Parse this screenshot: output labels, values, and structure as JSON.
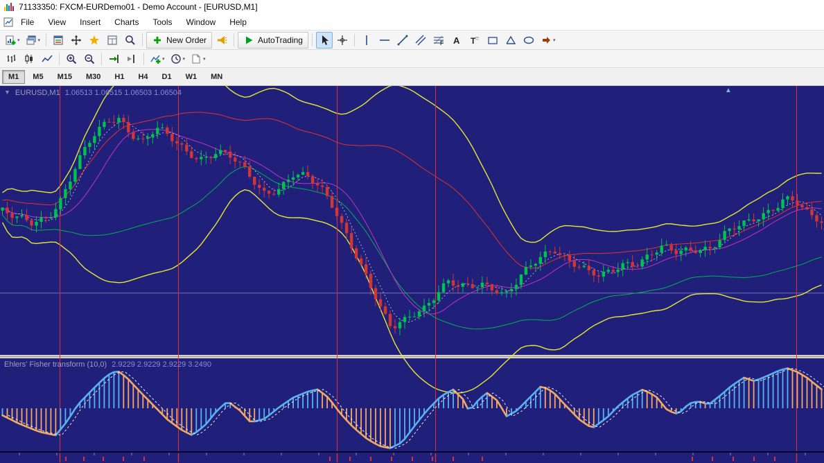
{
  "window": {
    "title": "71133350: FXCM-EURDemo01 - Demo Account - [EURUSD,M1]"
  },
  "menu": {
    "items": [
      "File",
      "View",
      "Insert",
      "Charts",
      "Tools",
      "Window",
      "Help"
    ]
  },
  "toolbar1": {
    "items": [
      {
        "icon": "new-chart",
        "name": "new-chart-button",
        "caret": true
      },
      {
        "icon": "profiles",
        "name": "profiles-button",
        "caret": true
      },
      {
        "sep": true
      },
      {
        "icon": "market-watch",
        "name": "market-watch-button"
      },
      {
        "icon": "navigator",
        "name": "navigator-button"
      },
      {
        "icon": "favorites",
        "name": "favorites-button"
      },
      {
        "icon": "data-window",
        "name": "data-window-button"
      },
      {
        "icon": "search",
        "name": "search-button"
      },
      {
        "sep": true
      },
      {
        "icon": "order-plus",
        "name": "new-order-button",
        "label": "New Order"
      },
      {
        "icon": "alerts",
        "name": "alerts-button"
      },
      {
        "sep": true
      },
      {
        "icon": "play",
        "name": "autotrading-button",
        "label": "AutoTrading"
      },
      {
        "sep": true
      },
      {
        "icon": "cursor",
        "name": "cursor-tool-button",
        "pressed": true
      },
      {
        "icon": "crosshair",
        "name": "crosshair-tool-button"
      },
      {
        "sep": true
      },
      {
        "icon": "vline",
        "name": "vertical-line-tool-button"
      },
      {
        "icon": "hline",
        "name": "horizontal-line-tool-button"
      },
      {
        "icon": "tline",
        "name": "trendline-tool-button"
      },
      {
        "icon": "channel",
        "name": "equidistant-channel-tool-button"
      },
      {
        "icon": "fibo",
        "name": "fibonacci-retracement-tool-button"
      },
      {
        "icon": "text",
        "name": "text-tool-button"
      },
      {
        "icon": "label",
        "name": "text-label-tool-button"
      },
      {
        "icon": "rect-shape",
        "name": "rectangle-tool-button"
      },
      {
        "icon": "triangle-shape",
        "name": "triangle-tool-button"
      },
      {
        "icon": "ellipse-shape",
        "name": "ellipse-tool-button"
      },
      {
        "icon": "arrows",
        "name": "arrows-tool-button",
        "caret": true
      }
    ]
  },
  "toolbar2": {
    "items": [
      {
        "icon": "bars-chart",
        "name": "bar-chart-button"
      },
      {
        "icon": "candles-chart",
        "name": "candlestick-chart-button"
      },
      {
        "icon": "line-chart",
        "name": "line-chart-button"
      },
      {
        "sep": true
      },
      {
        "icon": "zoom-in",
        "name": "zoom-in-button"
      },
      {
        "icon": "zoom-out",
        "name": "zoom-out-button"
      },
      {
        "sep": true
      },
      {
        "icon": "auto-scroll",
        "name": "auto-scroll-button"
      },
      {
        "icon": "chart-shift",
        "name": "chart-shift-button"
      },
      {
        "sep": true
      },
      {
        "icon": "indicators",
        "name": "indicators-button",
        "caret": true
      },
      {
        "icon": "periods",
        "name": "periods-button",
        "caret": true
      },
      {
        "icon": "templates",
        "name": "templates-button",
        "caret": true
      }
    ]
  },
  "timeframes": {
    "items": [
      "M1",
      "M5",
      "M15",
      "M30",
      "H1",
      "H4",
      "D1",
      "W1",
      "MN"
    ],
    "active": "M1"
  },
  "chart": {
    "symbol_label": "EURUSD,M1",
    "ohlc": "1.06513 1.06515 1.06503 1.06504",
    "indicator_label": "Ehlers' Fisher transform (10,0)",
    "indicator_values": "2.9229 2.9229 2.9229 3.2490",
    "collapse_marker": "▼",
    "corner_marker": "▲"
  },
  "chart_data": {
    "type": "candlestick",
    "symbol": "EURUSD",
    "timeframe": "M1",
    "open": 1.06513,
    "high": 1.06515,
    "low": 1.06503,
    "close": 1.06504,
    "current_price": 1.06504,
    "price_axis": {
      "top": 1.0692,
      "bottom": 1.0638
    },
    "num_candles": 170,
    "price_path": [
      [
        0.0,
        1.0667
      ],
      [
        0.015,
        1.0665
      ],
      [
        0.035,
        1.0664
      ],
      [
        0.055,
        1.0666
      ],
      [
        0.072,
        1.067
      ],
      [
        0.09,
        1.0676
      ],
      [
        0.11,
        1.0681
      ],
      [
        0.13,
        1.0685
      ],
      [
        0.143,
        1.0686
      ],
      [
        0.158,
        1.0683
      ],
      [
        0.172,
        1.0681
      ],
      [
        0.188,
        1.0683
      ],
      [
        0.205,
        1.0681
      ],
      [
        0.225,
        1.0679
      ],
      [
        0.245,
        1.0678
      ],
      [
        0.262,
        1.0679
      ],
      [
        0.28,
        1.0677
      ],
      [
        0.3,
        1.0674
      ],
      [
        0.318,
        1.0671
      ],
      [
        0.338,
        1.0672
      ],
      [
        0.355,
        1.0674
      ],
      [
        0.372,
        1.0673
      ],
      [
        0.39,
        1.0671
      ],
      [
        0.405,
        1.0668
      ],
      [
        0.42,
        1.0663
      ],
      [
        0.435,
        1.0657
      ],
      [
        0.45,
        1.0651
      ],
      [
        0.463,
        1.0646
      ],
      [
        0.475,
        1.0643
      ],
      [
        0.488,
        1.0645
      ],
      [
        0.5,
        1.0647
      ],
      [
        0.515,
        1.0648
      ],
      [
        0.53,
        1.065
      ],
      [
        0.545,
        1.0652
      ],
      [
        0.558,
        1.0651
      ],
      [
        0.572,
        1.0652
      ],
      [
        0.588,
        1.0653
      ],
      [
        0.6,
        1.0652
      ],
      [
        0.613,
        1.065
      ],
      [
        0.628,
        1.0652
      ],
      [
        0.643,
        1.0655
      ],
      [
        0.66,
        1.0658
      ],
      [
        0.673,
        1.066
      ],
      [
        0.688,
        1.0658
      ],
      [
        0.702,
        1.0656
      ],
      [
        0.716,
        1.0654
      ],
      [
        0.73,
        1.0653
      ],
      [
        0.745,
        1.0655
      ],
      [
        0.76,
        1.0657
      ],
      [
        0.775,
        1.0657
      ],
      [
        0.79,
        1.0658
      ],
      [
        0.805,
        1.0659
      ],
      [
        0.82,
        1.0658
      ],
      [
        0.835,
        1.0659
      ],
      [
        0.85,
        1.066
      ],
      [
        0.865,
        1.066
      ],
      [
        0.88,
        1.0662
      ],
      [
        0.895,
        1.0663
      ],
      [
        0.91,
        1.0664
      ],
      [
        0.925,
        1.0666
      ],
      [
        0.94,
        1.0668
      ],
      [
        0.955,
        1.067
      ],
      [
        0.968,
        1.0669
      ],
      [
        0.98,
        1.0666
      ],
      [
        1.0,
        1.0664
      ]
    ],
    "separators_x": [
      0.072,
      0.216,
      0.409,
      0.528,
      0.966
    ],
    "axis_marks": [
      0.08,
      0.102,
      0.125,
      0.15,
      0.175,
      0.4,
      0.425,
      0.45,
      0.475,
      0.5,
      0.525,
      0.55,
      0.585,
      0.84,
      0.865,
      0.89,
      0.915,
      0.94
    ],
    "colors": {
      "background": "#20207a",
      "up": "#00c24e",
      "down": "#d23535",
      "band": "#e6e635",
      "ma_red": "#e03030",
      "ma_green": "#00b050",
      "ma_center": "#c233c2",
      "ma_fast": "#cfcfe8",
      "price_line": "#8d8dc8",
      "separator": "#e03030"
    },
    "fisher": {
      "name": "Ehlers' Fisher transform",
      "params": "(10,0)",
      "last_values": [
        2.9229,
        2.9229,
        2.9229,
        3.249
      ],
      "up_color": "#5ab1f0",
      "down_color": "#f2a963",
      "signal_color": "#ffffff",
      "values_path": [
        [
          0.0,
          -0.6
        ],
        [
          0.02,
          -1.3
        ],
        [
          0.045,
          -2.0
        ],
        [
          0.065,
          -2.3
        ],
        [
          0.078,
          -1.2
        ],
        [
          0.092,
          0.3
        ],
        [
          0.11,
          1.6
        ],
        [
          0.128,
          2.8
        ],
        [
          0.14,
          3.2
        ],
        [
          0.152,
          2.6
        ],
        [
          0.168,
          1.4
        ],
        [
          0.185,
          0.2
        ],
        [
          0.202,
          -1.0
        ],
        [
          0.22,
          -1.9
        ],
        [
          0.232,
          -2.3
        ],
        [
          0.248,
          -1.4
        ],
        [
          0.262,
          -0.2
        ],
        [
          0.275,
          0.6
        ],
        [
          0.29,
          -0.2
        ],
        [
          0.303,
          -1.2
        ],
        [
          0.32,
          -0.9
        ],
        [
          0.338,
          0.1
        ],
        [
          0.355,
          0.9
        ],
        [
          0.372,
          1.4
        ],
        [
          0.385,
          1.6
        ],
        [
          0.398,
          0.9
        ],
        [
          0.412,
          -0.4
        ],
        [
          0.428,
          -1.6
        ],
        [
          0.445,
          -2.6
        ],
        [
          0.46,
          -3.2
        ],
        [
          0.473,
          -3.4
        ],
        [
          0.488,
          -2.9
        ],
        [
          0.502,
          -1.6
        ],
        [
          0.518,
          -0.2
        ],
        [
          0.535,
          1.0
        ],
        [
          0.55,
          1.6
        ],
        [
          0.562,
          0.8
        ],
        [
          0.57,
          -0.3
        ],
        [
          0.582,
          0.8
        ],
        [
          0.592,
          1.3
        ],
        [
          0.605,
          0.6
        ],
        [
          0.615,
          -0.7
        ],
        [
          0.628,
          -0.2
        ],
        [
          0.645,
          1.0
        ],
        [
          0.658,
          1.9
        ],
        [
          0.672,
          1.4
        ],
        [
          0.688,
          0.2
        ],
        [
          0.705,
          -1.0
        ],
        [
          0.72,
          -1.7
        ],
        [
          0.738,
          -0.8
        ],
        [
          0.752,
          0.2
        ],
        [
          0.768,
          1.1
        ],
        [
          0.782,
          1.6
        ],
        [
          0.798,
          1.0
        ],
        [
          0.812,
          -0.2
        ],
        [
          0.825,
          -0.5
        ],
        [
          0.838,
          0.4
        ],
        [
          0.85,
          0.6
        ],
        [
          0.862,
          0.3
        ],
        [
          0.875,
          1.0
        ],
        [
          0.89,
          1.9
        ],
        [
          0.905,
          2.6
        ],
        [
          0.918,
          2.3
        ],
        [
          0.932,
          2.7
        ],
        [
          0.948,
          3.2
        ],
        [
          0.958,
          3.4
        ],
        [
          0.97,
          3.1
        ],
        [
          0.982,
          2.6
        ],
        [
          1.0,
          1.6
        ]
      ]
    }
  }
}
